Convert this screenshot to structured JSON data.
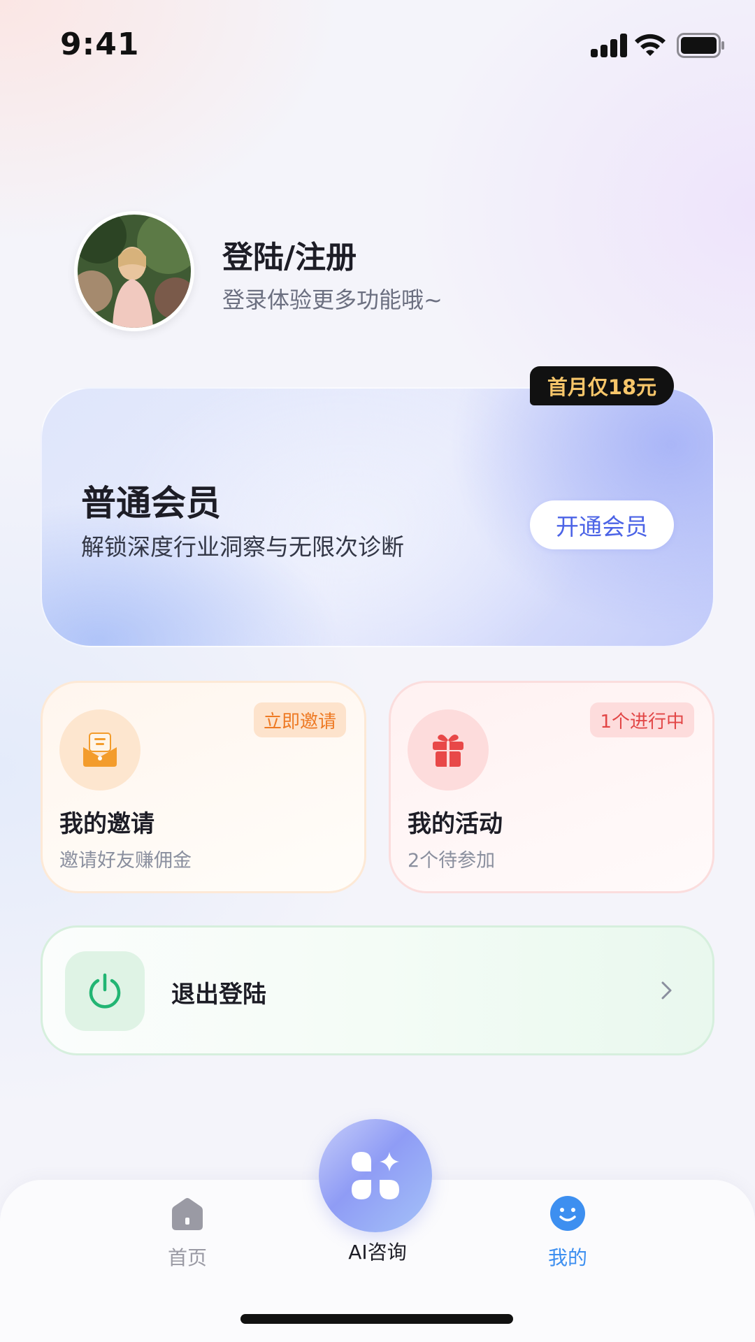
{
  "status_bar": {
    "time": "9:41"
  },
  "profile": {
    "title": "登陆/注册",
    "subtitle": "登录体验更多功能哦~"
  },
  "member_card": {
    "promo_tag": "首月仅18元",
    "title": "普通会员",
    "subtitle": "解锁深度行业洞察与无限次诊断",
    "button_label": "开通会员",
    "colors": {
      "button_text": "#4b63e6",
      "promo_text": "#f7c66a"
    }
  },
  "cards": {
    "invite": {
      "badge": "立即邀请",
      "title": "我的邀请",
      "subtitle": "邀请好友赚佣金",
      "icon": "envelope-icon",
      "accent": "#f39c2c"
    },
    "activity": {
      "badge": "1个进行中",
      "title": "我的活动",
      "subtitle": "2个待参加",
      "icon": "gift-icon",
      "accent": "#e84848"
    }
  },
  "logout": {
    "label": "退出登陆",
    "icon": "power-icon",
    "accent": "#22b573"
  },
  "tabbar": {
    "home": {
      "label": "首页",
      "icon": "home-icon"
    },
    "ai": {
      "label": "AI咨询",
      "icon": "clover-sparkle-icon"
    },
    "mine": {
      "label": "我的",
      "icon": "smile-icon",
      "active": true,
      "color": "#3d8ff0"
    }
  }
}
